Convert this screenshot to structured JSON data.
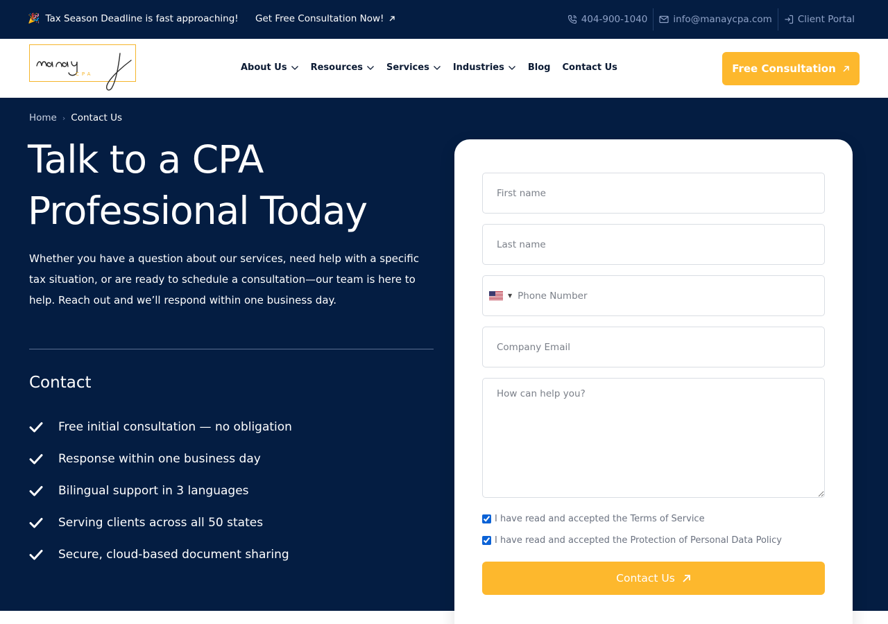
{
  "topbar": {
    "announcement": "Tax Season Deadline is fast approaching!",
    "cta_link": "Get Free Consultation Now!",
    "phone": "404-900-1040",
    "email": "info@manaycpa.com",
    "portal": "Client Portal"
  },
  "header": {
    "logo_script": "manay",
    "logo_sub": "CPA",
    "nav": [
      {
        "label": "About Us",
        "dropdown": true
      },
      {
        "label": "Resources",
        "dropdown": true
      },
      {
        "label": "Services",
        "dropdown": true
      },
      {
        "label": "Industries",
        "dropdown": true
      },
      {
        "label": "Blog",
        "dropdown": false
      },
      {
        "label": "Contact Us",
        "dropdown": false
      }
    ],
    "cta_button": "Free Consultation"
  },
  "breadcrumb": {
    "home": "Home",
    "current": "Contact Us"
  },
  "hero": {
    "title_line1": "Talk to a CPA",
    "title_line2": "Professional Today",
    "description": "Whether you have a question about our services, need help with a specific tax situation, or are ready to schedule a consultation—our team is here to help. Reach out and we’ll respond within one business day."
  },
  "contact": {
    "heading": "Contact",
    "items": [
      "Free initial consultation — no obligation",
      "Response within one business day",
      "Bilingual support in 3 languages",
      "Serving clients across all 50 states",
      "Secure, cloud-based document sharing"
    ]
  },
  "form": {
    "first_name_placeholder": "First name",
    "last_name_placeholder": "Last name",
    "phone_placeholder": "Phone Number",
    "email_placeholder": "Company Email",
    "message_placeholder": "How can help you?",
    "consent_terms": "I have read and accepted the Terms of Service",
    "consent_privacy": "I have read and accepted the Protection of Personal Data Policy",
    "consent_terms_checked": true,
    "consent_privacy_checked": true,
    "submit_label": "Contact Us"
  },
  "colors": {
    "navy": "#041d42",
    "accent": "#fdb82d"
  }
}
